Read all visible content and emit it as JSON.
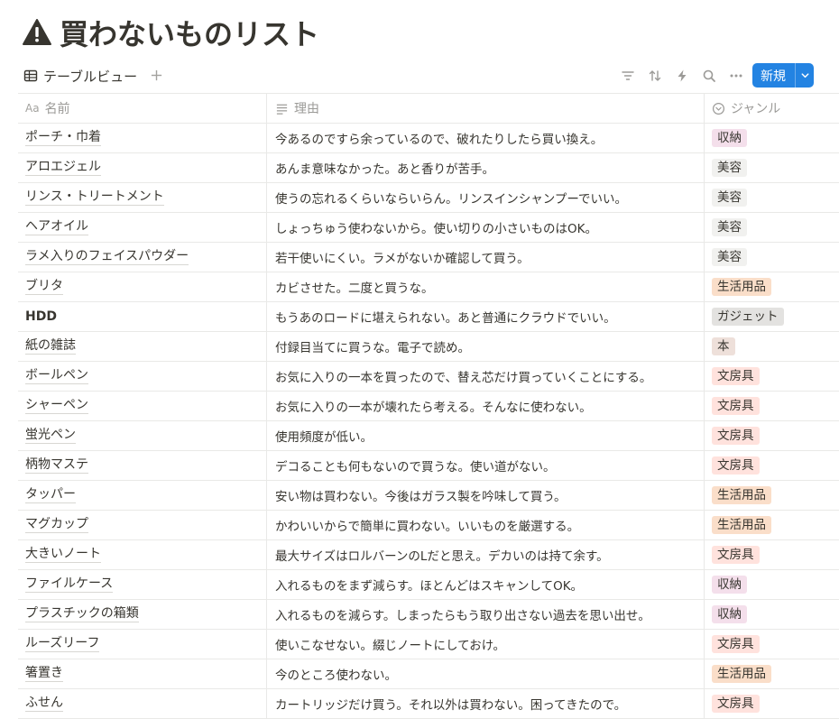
{
  "page": {
    "title": "買わないものリスト",
    "title_icon": "warning-icon"
  },
  "toolbar": {
    "view_label": "テーブルビュー",
    "new_label": "新規"
  },
  "columns": {
    "name": "名前",
    "name_prefix": "Aa",
    "reason": "理由",
    "genre": "ジャンル"
  },
  "tag_colors": {
    "収納": "#f4dfeb",
    "美容": "#f1f1ef",
    "生活用品": "#fadec9",
    "ガジェット": "#e3e2e0",
    "本": "#eee0da",
    "文房具": "#ffe2dd"
  },
  "rows": [
    {
      "name": "ポーチ・巾着",
      "reason": "今あるのですら余っているので、破れたりしたら買い換え。",
      "genre": "収納"
    },
    {
      "name": "アロエジェル",
      "reason": "あんま意味なかった。あと香りが苦手。",
      "genre": "美容"
    },
    {
      "name": "リンス・トリートメント",
      "reason": "使うの忘れるくらいならいらん。リンスインシャンプーでいい。",
      "genre": "美容"
    },
    {
      "name": "ヘアオイル",
      "reason": "しょっちゅう使わないから。使い切りの小さいものはOK。",
      "genre": "美容"
    },
    {
      "name": "ラメ入りのフェイスパウダー",
      "reason": "若干使いにくい。ラメがないか確認して買う。",
      "genre": "美容"
    },
    {
      "name": "ブリタ",
      "reason": "カビさせた。二度と買うな。",
      "genre": "生活用品"
    },
    {
      "name": "HDD",
      "reason": "もうあのロードに堪えられない。あと普通にクラウドでいい。",
      "genre": "ガジェット",
      "bold": true
    },
    {
      "name": "紙の雑誌",
      "reason": "付録目当てに買うな。電子で読め。",
      "genre": "本"
    },
    {
      "name": "ボールペン",
      "reason": "お気に入りの一本を買ったので、替え芯だけ買っていくことにする。",
      "genre": "文房具"
    },
    {
      "name": "シャーペン",
      "reason": "お気に入りの一本が壊れたら考える。そんなに使わない。",
      "genre": "文房具"
    },
    {
      "name": "蛍光ペン",
      "reason": "使用頻度が低い。",
      "genre": "文房具"
    },
    {
      "name": "柄物マステ",
      "reason": "デコることも何もないので買うな。使い道がない。",
      "genre": "文房具"
    },
    {
      "name": "タッパー",
      "reason": "安い物は買わない。今後はガラス製を吟味して買う。",
      "genre": "生活用品"
    },
    {
      "name": "マグカップ",
      "reason": "かわいいからで簡単に買わない。いいものを厳選する。",
      "genre": "生活用品"
    },
    {
      "name": "大きいノート",
      "reason": "最大サイズはロルバーンのLだと思え。デカいのは持て余す。",
      "genre": "文房具"
    },
    {
      "name": "ファイルケース",
      "reason": "入れるものをまず減らす。ほとんどはスキャンしてOK。",
      "genre": "収納"
    },
    {
      "name": "プラスチックの箱類",
      "reason": "入れるものを減らす。しまったらもう取り出さない過去を思い出せ。",
      "genre": "収納"
    },
    {
      "name": "ルーズリーフ",
      "reason": "使いこなせない。綴じノートにしておけ。",
      "genre": "文房具"
    },
    {
      "name": "箸置き",
      "reason": "今のところ使わない。",
      "genre": "生活用品"
    },
    {
      "name": "ふせん",
      "reason": "カートリッジだけ買う。それ以外は買わない。困ってきたので。",
      "genre": "文房具"
    }
  ]
}
